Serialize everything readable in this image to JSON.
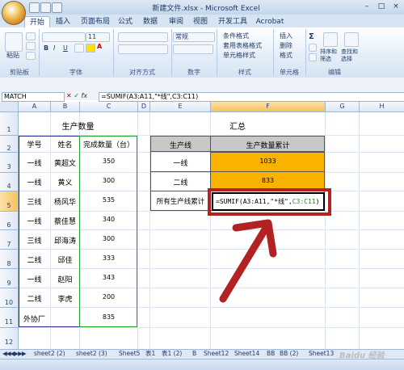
{
  "window": {
    "title": "新建文件.xlsx - Microsoft Excel"
  },
  "ribbon_tabs": [
    "开始",
    "插入",
    "页面布局",
    "公式",
    "数据",
    "审阅",
    "视图",
    "开发工具",
    "Acrobat"
  ],
  "ribbon": {
    "paste_label": "粘贴",
    "font_name": "",
    "font_size": "11",
    "number_format": "常规",
    "cond_format": "条件格式",
    "table_format": "套用表格格式",
    "cell_style": "单元格样式",
    "insert": "插入",
    "delete": "删除",
    "format": "格式",
    "sort_filter": "排序和筛选",
    "find_select": "查找和选择",
    "groups": {
      "clipboard": "剪贴板",
      "font": "字体",
      "alignment": "对齐方式",
      "number": "数字",
      "styles": "样式",
      "cells": "单元格",
      "editing": "编辑"
    }
  },
  "formula_bar": {
    "name_box": "MATCH",
    "fx": "fx",
    "formula": "=SUMIF(A3:A11,\"*线\",C3:C11)"
  },
  "columns": [
    "A",
    "B",
    "C",
    "D",
    "E",
    "F",
    "G",
    "H"
  ],
  "rows": [
    "1",
    "2",
    "3",
    "4",
    "5",
    "6",
    "7",
    "8",
    "9",
    "10",
    "11",
    "12"
  ],
  "left_table": {
    "title": "生产数量",
    "headers": [
      "学号",
      "姓名",
      "完成数量（台）"
    ],
    "rows": [
      [
        "一线",
        "黄超文",
        "350"
      ],
      [
        "一线",
        "黄义",
        "300"
      ],
      [
        "三线",
        "杨风华",
        "535"
      ],
      [
        "一线",
        "蔡佳慧",
        "340"
      ],
      [
        "三线",
        "邱海涛",
        "300"
      ],
      [
        "二线",
        "邱佳",
        "333"
      ],
      [
        "一线",
        "赵阳",
        "343"
      ],
      [
        "二线",
        "李虎",
        "200"
      ],
      [
        "外协厂",
        "",
        "835"
      ]
    ]
  },
  "right_table": {
    "title": "汇总",
    "headers": [
      "生产线",
      "生产数量累计"
    ],
    "rows": [
      [
        "一线",
        "1033"
      ],
      [
        "二线",
        "833"
      ]
    ],
    "total_label": "所有生产线累计",
    "total_formula": "=SUMIF(A3:A11,\"*线\",C3:C11)",
    "formula_prefix": "=SUMIF(A3:A11,\"*线\",",
    "formula_range": "C3:C11",
    "formula_suffix": ")"
  },
  "sheet_tabs": [
    "sheet2 (2)",
    "sheet2 (3)",
    "Sheet5",
    "表1",
    "表1 (2)",
    "B",
    "Sheet12",
    "Sheet14",
    "BB",
    "BB (2)",
    "Sheet13"
  ],
  "colors": {
    "accent_fill": "#f9b200",
    "header_fill": "#c8c8c8",
    "arrow": "#b22222",
    "selection": "#f6c25e"
  },
  "watermark": "Baidu 经验"
}
